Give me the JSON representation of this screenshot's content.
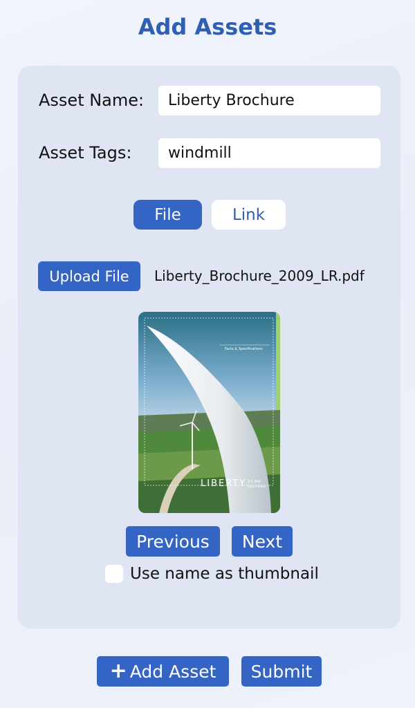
{
  "page": {
    "title": "Add Assets"
  },
  "form": {
    "asset_name_label": "Asset Name:",
    "asset_name_value": "Liberty Brochure",
    "asset_tags_label": "Asset Tags:",
    "asset_tags_value": "windmill"
  },
  "source_toggle": {
    "options": [
      "File",
      "Link"
    ],
    "selected": "File"
  },
  "upload": {
    "button_label": "Upload File",
    "file_name": "Liberty_Brochure_2009_LR.pdf"
  },
  "preview": {
    "cover_title": "LIBERTY",
    "cover_subtitle": "2.5 MW",
    "cover_caption": "WIND TURBINE",
    "cover_header": "Facts & Specifications"
  },
  "pager": {
    "previous_label": "Previous",
    "next_label": "Next"
  },
  "thumbnail_option": {
    "label": "Use name as thumbnail",
    "checked": false
  },
  "actions": {
    "add_icon": "plus-icon",
    "add_label": "Add Asset",
    "submit_label": "Submit"
  },
  "colors": {
    "accent": "#3464c4",
    "title": "#2f5fb3",
    "card": "#dfe5f2"
  }
}
